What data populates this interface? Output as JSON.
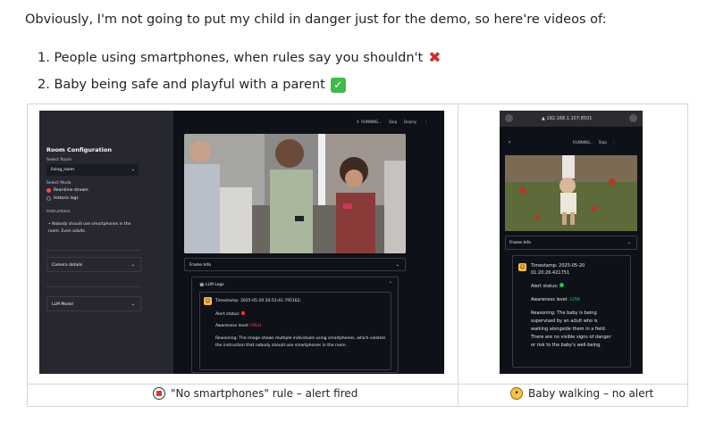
{
  "intro": "Obviously, I'm not going to put my child in danger just for the demo, so here're videos of:",
  "list": [
    {
      "label": "1. People using smartphones, when rules say you shouldn't",
      "icon": "red-x-icon"
    },
    {
      "label": "2. Baby being safe and playful with a parent",
      "icon": "green-check-icon"
    }
  ],
  "desktop": {
    "topbar": {
      "status": "RUNNING...",
      "stop": "Stop",
      "deploy": "Deploy",
      "menu": "⋮"
    },
    "sidebar": {
      "title": "Room Configuration",
      "room_label": "Select Room",
      "room_value": "living_room",
      "mode_label": "Select Mode",
      "mode_options": [
        "Real-time stream",
        "Historic logs"
      ],
      "instructions_label": "Instructions",
      "instruction": "Nobody should use smartphones in the room. Even adults.",
      "camera_details": "Camera details",
      "llm_model": "LLM Model"
    },
    "frame_info": "Frame Info",
    "llm_logs": "LLM Logs",
    "log": {
      "timestamp": "Timestamp: 2025-05-20 20:53:41.795162;",
      "alert": "Alert status:",
      "awareness_label": "Awareness level:",
      "awareness_value": "HIGH",
      "reasoning_1": "Reasoning: The image shows multiple individuals using smartphones, which violates",
      "reasoning_2": "the instruction that nobody should use smartphones in the room."
    },
    "caption": "\"No smartphones\" rule – alert fired"
  },
  "phone": {
    "url": "192.168.1.107:8501",
    "status": "RUNNING...",
    "stop": "Stop",
    "menu": "⋮",
    "frame_info": "Frame Info",
    "timestamp_1": "Timestamp: 2025-05-20",
    "timestamp_2": "01:20:26.421751",
    "alert": "Alert status:",
    "awareness_label": "Awareness level:",
    "awareness_value": "LOW",
    "reasoning": [
      "Reasoning: The baby is being",
      "supervised by an adult who is",
      "walking alongside them in a field.",
      "There are no visible signs of danger",
      "or risk to the baby's well-being."
    ],
    "caption": "Baby walking – no alert"
  }
}
